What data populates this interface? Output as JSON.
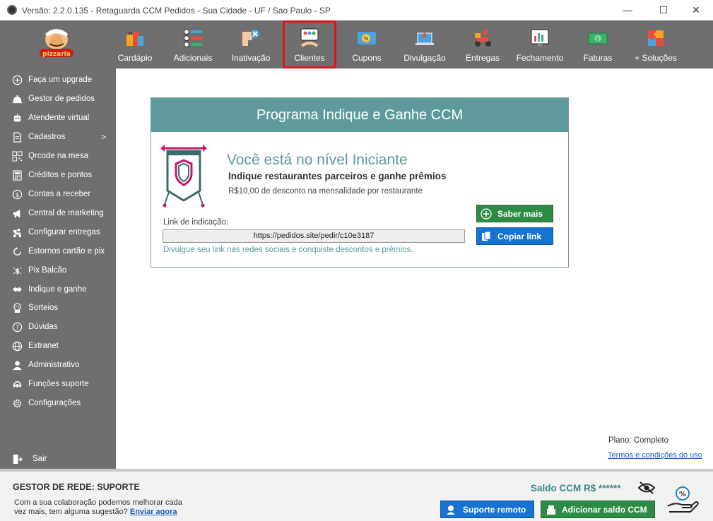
{
  "window": {
    "title": "Versão: 2.2.0.135 - Retaguarda CCM Pedidos - Sua Cidade - UF / Sao Paulo - SP",
    "minimize": "—",
    "maximize": "☐",
    "close": "✕"
  },
  "toolbar": {
    "items": [
      {
        "label": "Cardápio"
      },
      {
        "label": "Adicionais"
      },
      {
        "label": "Inativação"
      },
      {
        "label": "Clientes"
      },
      {
        "label": "Cupons"
      },
      {
        "label": "Divulgação"
      },
      {
        "label": "Entregas"
      },
      {
        "label": "Fechamento"
      },
      {
        "label": "Faturas"
      },
      {
        "label": "+ Soluções"
      }
    ],
    "highlighted": "Clientes",
    "highlight_color": "#e0141a"
  },
  "sidebar": {
    "items": [
      {
        "label": "Faça um upgrade",
        "icon": "plus-circle-icon"
      },
      {
        "label": "Gestor de pedidos",
        "icon": "cloche-icon"
      },
      {
        "label": "Atendente virtual",
        "icon": "robot-icon"
      },
      {
        "label": "Cadastros",
        "icon": "document-icon",
        "chevron": ">"
      },
      {
        "label": "Qrcode na mesa",
        "icon": "qrcode-icon"
      },
      {
        "label": "Créditos e pontos",
        "icon": "calculator-icon"
      },
      {
        "label": "Contas a receber",
        "icon": "money-icon"
      },
      {
        "label": "Central de marketing",
        "icon": "megaphone-icon"
      },
      {
        "label": "Configurar entregas",
        "icon": "delivery-icon"
      },
      {
        "label": "Estornos cartão e pix",
        "icon": "refund-icon"
      },
      {
        "label": "Pix Balcão",
        "icon": "pix-icon"
      },
      {
        "label": "Indique e ganhe",
        "icon": "handshake-icon"
      },
      {
        "label": "Sorteios",
        "icon": "raffle-icon"
      },
      {
        "label": "Dúvidas",
        "icon": "question-icon"
      },
      {
        "label": "Extranet",
        "icon": "globe-icon"
      },
      {
        "label": "Administrativo",
        "icon": "user-icon"
      },
      {
        "label": "Funções suporte",
        "icon": "headset-icon"
      },
      {
        "label": "Configurações",
        "icon": "gear-icon"
      }
    ],
    "logout": {
      "label": "Sair",
      "icon": "logout-icon"
    }
  },
  "card": {
    "header": "Programa Indique e Ganhe CCM",
    "level": "Você está no nível  Iniciante",
    "subtitle": "Indique restaurantes parceiros e ganhe prêmios",
    "discount": "R$10,00 de desconto na mensalidade por restaurante",
    "link_label": "Link de indicação:",
    "link_value": "https://pedidos.site/pedir/c10e3187",
    "note": "Divulgue seu link nas redes sociais e conquiste descontos e prêmios.",
    "saber_mais": "Saber mais",
    "copiar_link": "Copiar link"
  },
  "plan": {
    "plano": "Plano: Completo",
    "termos": "Termos e condições do uso"
  },
  "footer": {
    "gestor": "GESTOR DE REDE: SUPORTE",
    "colab_text": "Com a sua colaboração podemos melhorar cada vez mais, tem alguma sugestão?",
    "colab_link": "Enviar agora",
    "saldo": "Saldo CCM R$ ******",
    "suporte_remoto": "Suporte remoto",
    "adicionar_saldo": "Adicionar saldo CCM"
  },
  "colors": {
    "toolbar_bg": "#6f6f6f",
    "teal": "#5e9a9b",
    "green": "#2e8b45",
    "blue": "#1673d2"
  }
}
